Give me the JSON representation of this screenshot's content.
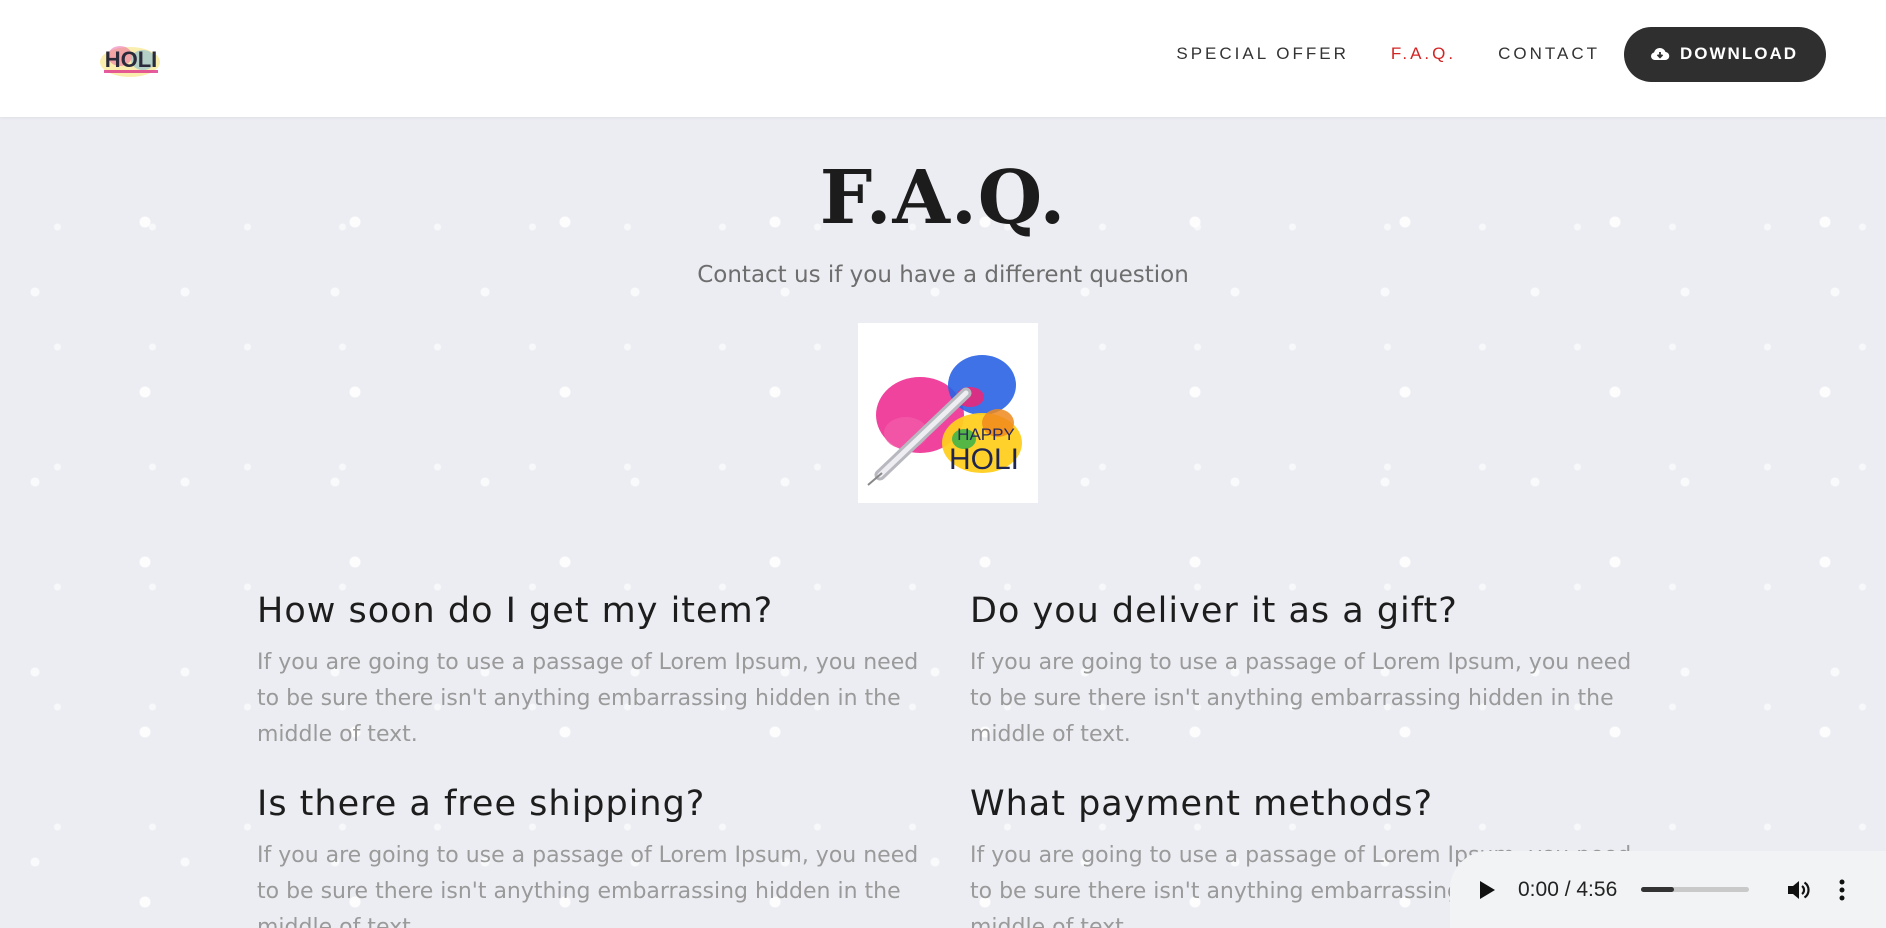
{
  "header": {
    "logo_text": "HOLI",
    "nav": {
      "special_offer": "SPECIAL OFFER",
      "faq": "F.A.Q.",
      "contact": "CONTACT",
      "download": "DOWNLOAD"
    },
    "active_color": "#d32424"
  },
  "main": {
    "title": "F.A.Q.",
    "subtitle": "Contact us if you have a different question",
    "image_text": {
      "line1": "HAPPY",
      "line2": "HOLI"
    },
    "faqs": [
      {
        "question": "How soon do I get my item?",
        "answer": "If you are going to use a passage of Lorem Ipsum, you need to be sure there isn't anything embarrassing hidden in the middle of text."
      },
      {
        "question": "Do you deliver it as a gift?",
        "answer": "If you are going to use a passage of Lorem Ipsum, you need to be sure there isn't anything embarrassing hidden in the middle of text."
      },
      {
        "question": "Is there a free shipping?",
        "answer": "If you are going to use a passage of Lorem Ipsum, you need to be sure there isn't anything embarrassing hidden in the middle of text."
      },
      {
        "question": "What payment methods?",
        "answer": "If you are going to use a passage of Lorem Ipsum, you need to be sure there isn't anything embarrassing hidden in the middle of text."
      }
    ]
  },
  "audio": {
    "time": "0:00 / 4:56",
    "progress_fraction": 0.3
  }
}
